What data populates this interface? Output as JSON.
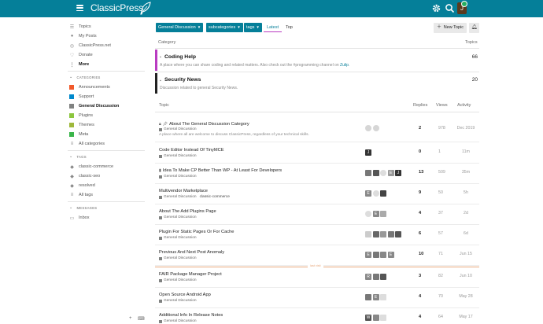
{
  "header": {
    "brand": "ClassicPress",
    "avatar_initial": "J",
    "accent": "#057f99"
  },
  "sidebar": {
    "items": [
      {
        "label": "Topics",
        "icon": "topics-icon"
      },
      {
        "label": "My Posts",
        "icon": "user-icon"
      },
      {
        "label": "ClassicPress.net",
        "icon": "globe-icon"
      },
      {
        "label": "Donate",
        "icon": "heart-icon"
      },
      {
        "label": "More",
        "icon": "more-icon"
      }
    ],
    "categories_heading": "CATEGORIES",
    "categories": [
      {
        "label": "Announcements",
        "color": "#f1592a"
      },
      {
        "label": "Support",
        "color": "#0088cc"
      },
      {
        "label": "General Discussion",
        "color": "#808281"
      },
      {
        "label": "Plugins",
        "color": "#8cc63f"
      },
      {
        "label": "Themes",
        "color": "#9eb83b"
      },
      {
        "label": "Meta",
        "color": "#3ab54a"
      }
    ],
    "all_categories": "All categories",
    "tags_heading": "TAGS",
    "tags": [
      "classic-commerce",
      "classic-seo",
      "resolved"
    ],
    "all_tags": "All tags",
    "messages_heading": "MESSAGES",
    "inbox": "Inbox"
  },
  "nav": {
    "category_filter": "General Discussion",
    "subcategories": "subcategories",
    "tags": "tags",
    "latest": "Latest",
    "top": "Top",
    "new_topic": "New Topic"
  },
  "categories_table": {
    "col_category": "Category",
    "col_topics": "Topics",
    "rows": [
      {
        "title": "Coding Help",
        "desc": "A place where you can share coding and related matters. Also check out the #programming channel on ",
        "link": "Zulip",
        "desc_end": ".",
        "count": "66",
        "color": "#b93bc1"
      },
      {
        "title": "Security News",
        "desc": "Discussion related to general Security News.",
        "count": "20",
        "color": "#222222"
      }
    ]
  },
  "topics_table": {
    "col_topic": "Topic",
    "col_replies": "Replies",
    "col_views": "Views",
    "col_activity": "Activity",
    "category_label": "General Discussion",
    "last_visit": "last visit",
    "rows": [
      {
        "title": "About The General Discussion Category",
        "excerpt": "A place where all are welcome to discuss ClassicPress, regardless of your technical skills.",
        "replies": "2",
        "views": "978",
        "activity": "Dec 2019",
        "posters": [
          "#cccccc",
          "#cccccc"
        ]
      },
      {
        "title": "Code Editor Instead Of TinyMCE",
        "tag": "",
        "replies": "0",
        "views": "1",
        "activity": "11m",
        "posters": [
          "#333333"
        ]
      },
      {
        "title": "Idea To Make CP Better Than WP - At Least For Developers",
        "tag": "",
        "replies": "13",
        "views": "509",
        "activity": "35m",
        "posters": [
          "#777777",
          "#555555",
          "#dddddd",
          "#999999",
          "#333333"
        ]
      },
      {
        "title": "Multivendor Marketplace",
        "tag": "classic-commerce",
        "replies": "9",
        "views": "50",
        "activity": "5h",
        "posters": [
          "#888888",
          "#dddddd",
          "#444444"
        ]
      },
      {
        "title": "About The Add Plugins Page",
        "tag": "",
        "replies": "4",
        "views": "37",
        "activity": "2d",
        "posters": [
          "#dddddd",
          "#888888",
          "#aaaaaa"
        ]
      },
      {
        "title": "Plugin For Static Pages Or For Cache",
        "tag": "",
        "replies": "6",
        "views": "57",
        "activity": "6d",
        "posters": [
          "#cccccc",
          "#666666",
          "#999999",
          "#777777",
          "#555555"
        ]
      },
      {
        "title": "Previous And Next Post Anomaly",
        "tag": "",
        "replies": "10",
        "views": "71",
        "activity": "Jun 15",
        "posters": [
          "#888888",
          "#777777",
          "#888888",
          "#888888"
        ]
      },
      {
        "title": "FAIR Package Manager Project",
        "tag": "",
        "replies": "3",
        "views": "82",
        "activity": "Jun 10",
        "posters": [
          "#888888",
          "#777777",
          "#555555"
        ]
      },
      {
        "title": "Open Source Android App",
        "tag": "",
        "replies": "4",
        "views": "70",
        "activity": "May 28",
        "posters": [
          "#777777",
          "#888888",
          "#dddddd"
        ]
      },
      {
        "title": "Additional Info In Release Notes",
        "tag": "",
        "replies": "4",
        "views": "64",
        "activity": "May 17",
        "posters": [
          "#555555",
          "#888888",
          "#dddddd"
        ]
      }
    ]
  }
}
